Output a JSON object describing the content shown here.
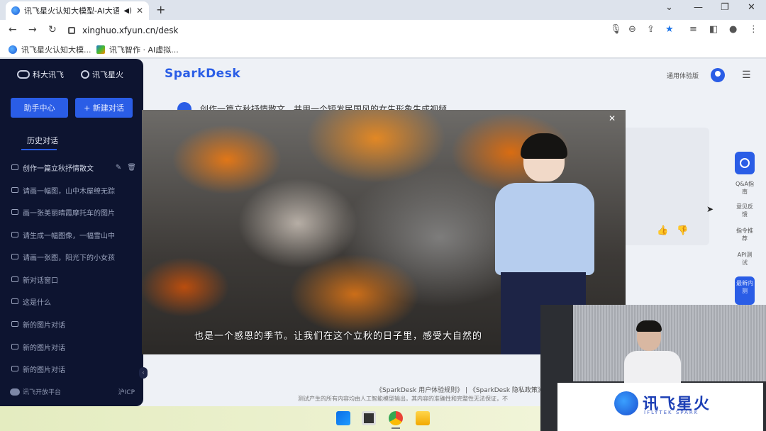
{
  "browser": {
    "tab_title": "讯飞星火认知大模型-AI大语",
    "url": "xinghuo.xfyun.cn/desk",
    "bookmarks": [
      "讯飞星火认知大模...",
      "讯飞智作 · AI虚拟..."
    ]
  },
  "sidebar": {
    "logo_left": "科大讯飞",
    "logo_right": "讯飞星火",
    "buttons": {
      "assistant_center": "助手中心",
      "new_chat": "+ 新建对话"
    },
    "history_title": "历史对话",
    "items": [
      "创作一篇立秋抒情散文",
      "请画一幅图，山中木屋缭无踪",
      "画一张美丽晴霞摩托车的图片",
      "请生成一幅图像，一幅雪山中",
      "请画一张图，阳光下的小女孩",
      "新对话窗口",
      "这是什么",
      "新的图片对话",
      "新的图片对话",
      "新的图片对话"
    ],
    "footer_left": "讯飞开放平台",
    "footer_right": "沪ICP"
  },
  "header": {
    "brand": "SparkDesk",
    "edition": "通用体验版"
  },
  "chat": {
    "prompt": "创作一篇立秋抒情散文，并用一个短发民国风的女生形象生成视频"
  },
  "right_rail": {
    "items": [
      "Q&A指南",
      "意见反馈",
      "指令推荐",
      "API测试"
    ],
    "blue_item": "最新内测"
  },
  "footer": {
    "links": "《SparkDesk 用户体验规则》 | 《SparkDesk 隐私政策》",
    "note": "测试产生的所有内容均由人工智能模型输出，其内容的准确性和完整性无法保证，不"
  },
  "video": {
    "subtitle": "也是一个感恩的季节。让我们在这个立秋的日子里，感受大自然的"
  },
  "stage": {
    "podium_text": "讯飞星火",
    "podium_sub": "IFLYTEK SPARK"
  },
  "colors": {
    "accent": "#2a5de6",
    "sidebar_bg": "#0d1430"
  }
}
